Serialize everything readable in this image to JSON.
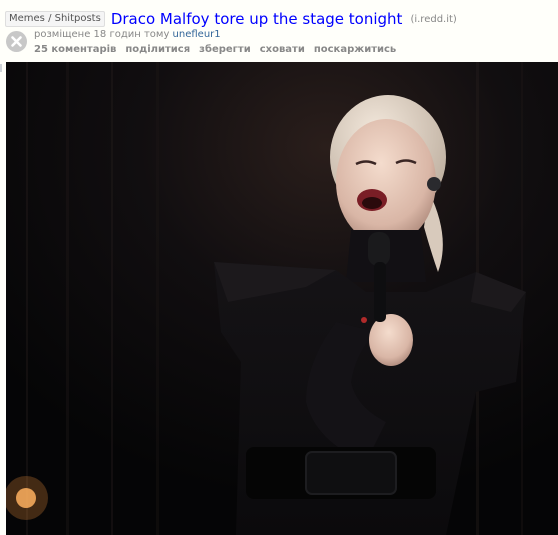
{
  "post": {
    "flair": "Memes / Shitposts",
    "title": "Draco Malfoy tore up the stage tonight",
    "domain": "(i.redd.it)",
    "tagline_prefix": "розміщене 18 годин тому",
    "author": "unefleur1",
    "buttons": {
      "comments": "25 коментарів",
      "share": "поділитися",
      "save": "зберегти",
      "hide": "сховати",
      "report": "поскаржитись"
    }
  },
  "colors": {
    "title_link": "#0000ff",
    "author_link": "#336699",
    "muted_text": "#888888",
    "photo_background": "#0a0a0d"
  },
  "icons": {
    "thumbnail": "close-x-thumbnail-icon"
  }
}
